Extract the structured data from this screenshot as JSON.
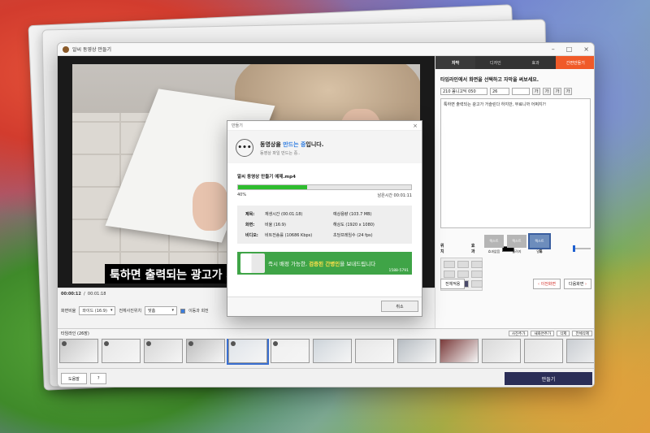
{
  "window": {
    "title": "알씨 동영상 만들기"
  },
  "video": {
    "subtitle": "툭하면 출력되는 광고가 거",
    "current_time": "00:00:12",
    "total_time": "00:01:18"
  },
  "controls": {
    "ratio_label": "화면비율",
    "ratio_value": "와이드 (16:9)",
    "fit_label": "전체사진위치",
    "fit_value": "맞춤",
    "checkbox_label": "이동과 회전"
  },
  "right_panel": {
    "tabs": [
      "자막",
      "디자인",
      "효과"
    ],
    "active_tab": 0,
    "simple_label": "간편만들기",
    "heading": "타임라인에서 화면을 선택하고 자막을 써보세요.",
    "font_name": "210 옴니고딕 050",
    "font_size": "26",
    "text": "툭하면 출력되는 광고가 거슬린다 하지만, 무료니까 어쩌지?!",
    "position_label": "위치",
    "effect_label": "효과",
    "opacity_label": "투명도",
    "effects": [
      {
        "label": "효과없음",
        "swatch": "텍스트"
      },
      {
        "label": "흘려지",
        "swatch": "텍스트"
      },
      {
        "label": "말풍",
        "swatch": "텍스트"
      }
    ],
    "apply_all": "전체적용",
    "prev_screen": "이전화면",
    "next_screen": "다음화면"
  },
  "timeline": {
    "label": "타임라인 (26장)",
    "add_photo": "사진추가",
    "add_new": "새화면추가",
    "delete": "삭제",
    "delete_all": "전체삭제",
    "thumb_count": 13
  },
  "bottom": {
    "help": "도움말",
    "question": "?",
    "make": "만들기"
  },
  "modal": {
    "title": "만들기",
    "close": "×",
    "icon": "•••",
    "status_pre": "동영상을 ",
    "status_hl": "만드는 중",
    "status_post": "입니다.",
    "sub": "동영상 파일 만드는 중..",
    "filename": "알씨 동영상 만들기 예제.mp4",
    "progress_percent": 40,
    "progress_label": "40%",
    "remaining": "남은시간 00:01:11",
    "info": [
      {
        "k": "제목:",
        "v1": "재생시간 (00:01:18)",
        "v2": "예상용량 (103.7 MB)"
      },
      {
        "k": "화면:",
        "v1": "비율 (16:9)",
        "v2": "해상도 (1920 x 1080)"
      },
      {
        "k": "비디오:",
        "v1": "비트전송률 (10686 Kbps)",
        "v2": "초당프레임수 (24 fps)"
      }
    ],
    "ad_pre": "즉시 배정 가능한, ",
    "ad_hl": "검증된 간병인",
    "ad_post": "을 보내드립니다",
    "ad_phone": "1588-5791",
    "cancel": "취소"
  },
  "colors": {
    "accent": "#f05a28",
    "progress": "#2ebd2e",
    "make_button": "#2b2e57"
  }
}
